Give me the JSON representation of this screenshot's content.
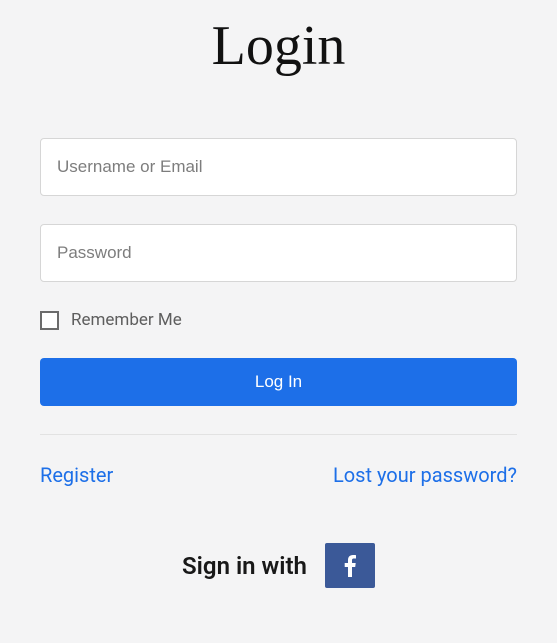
{
  "title": "Login",
  "fields": {
    "username_placeholder": "Username or Email",
    "password_placeholder": "Password"
  },
  "remember_label": "Remember Me",
  "login_button": "Log In",
  "links": {
    "register": "Register",
    "lost_password": "Lost your password?"
  },
  "social": {
    "label": "Sign in with"
  }
}
